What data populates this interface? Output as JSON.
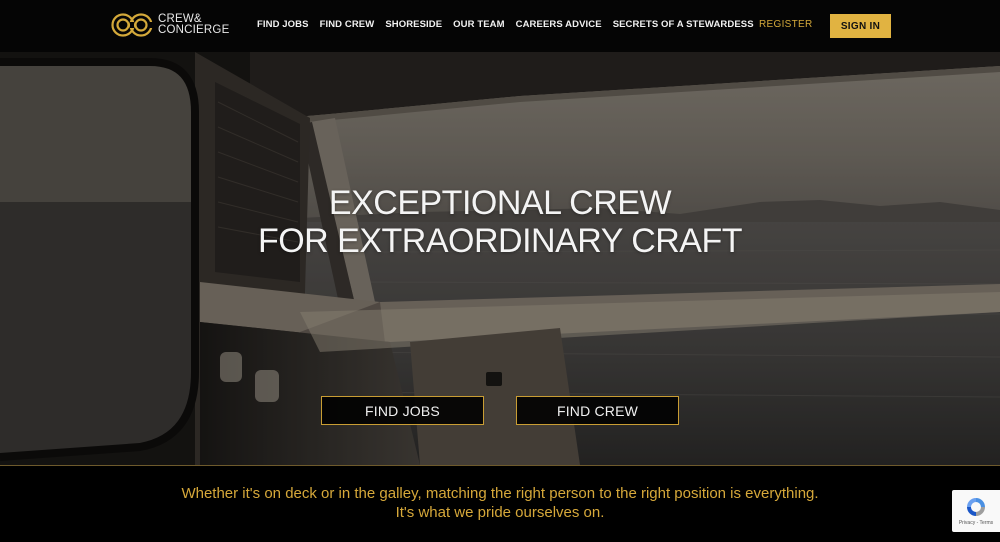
{
  "header": {
    "logo_line1": "CREW&",
    "logo_line2": "CONCIERGE",
    "nav": [
      {
        "label": "FIND JOBS"
      },
      {
        "label": "FIND CREW"
      },
      {
        "label": "SHORESIDE"
      },
      {
        "label": "OUR TEAM"
      },
      {
        "label": "CAREERS ADVICE"
      },
      {
        "label": "SECRETS OF A STEWARDESS"
      }
    ],
    "register_label": "REGISTER",
    "signin_label": "SIGN IN"
  },
  "hero": {
    "title_line1": "EXCEPTIONAL CREW",
    "title_line2": "FOR EXTRAORDINARY CRAFT",
    "find_jobs_label": "FIND JOBS",
    "find_crew_label": "FIND CREW"
  },
  "tagline": {
    "line1": "Whether it's on deck or in the galley, matching the right person to the right position is everything.",
    "line2": "It's what we pride ourselves on."
  },
  "recaptcha": {
    "text": "Privacy - Terms",
    "icon": "recaptcha-icon"
  },
  "colors": {
    "accent": "#e1b341",
    "gold_text": "#d6a83a",
    "header_bg": "#050505"
  }
}
